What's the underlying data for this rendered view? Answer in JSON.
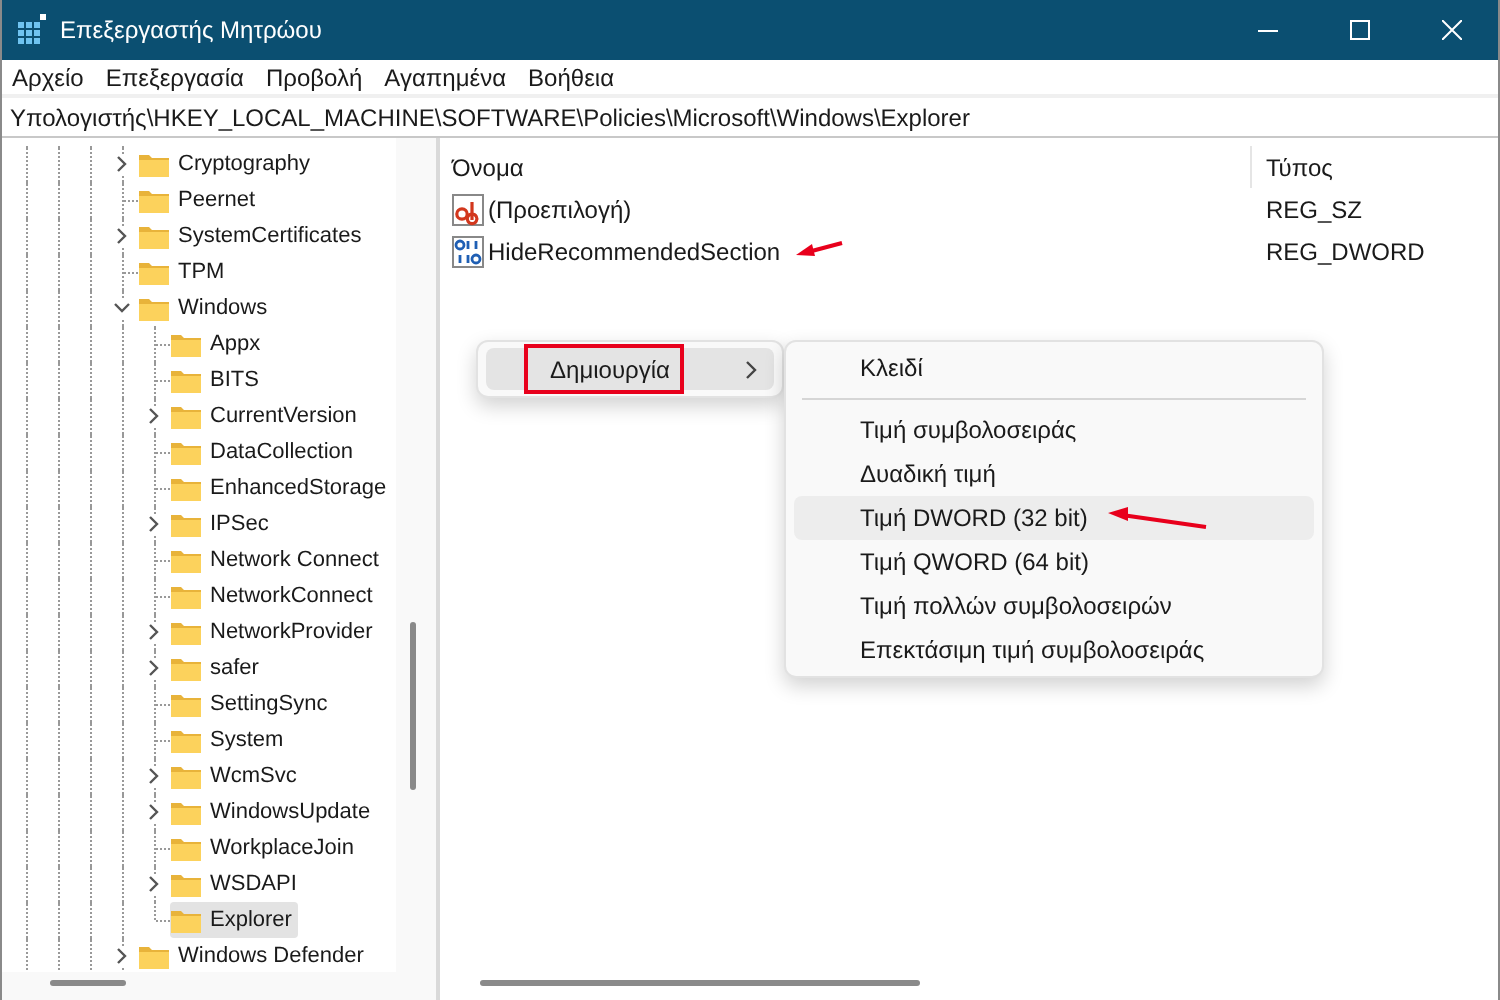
{
  "window": {
    "title": "Επεξεργαστής Μητρώου"
  },
  "menu_bar": [
    "Αρχείο",
    "Επεξεργασία",
    "Προβολή",
    "Αγαπημένα",
    "Βοήθεια"
  ],
  "address_bar": {
    "value": "Υπολογιστής\\HKEY_LOCAL_MACHINE\\SOFTWARE\\Policies\\Microsoft\\Windows\\Explorer"
  },
  "tree": [
    {
      "label": "Cryptography",
      "kind": "branch",
      "expanded": false,
      "selected": false
    },
    {
      "label": "Peernet",
      "kind": "leaf",
      "selected": false
    },
    {
      "label": "SystemCertificates",
      "kind": "branch",
      "expanded": false,
      "selected": false
    },
    {
      "label": "TPM",
      "kind": "leaf",
      "selected": false
    },
    {
      "label": "Windows",
      "kind": "branch",
      "expanded": true,
      "selected": false,
      "children": [
        {
          "label": "Appx",
          "kind": "leaf",
          "selected": false
        },
        {
          "label": "BITS",
          "kind": "leaf",
          "selected": false
        },
        {
          "label": "CurrentVersion",
          "kind": "branch",
          "expanded": false,
          "selected": false
        },
        {
          "label": "DataCollection",
          "kind": "leaf",
          "selected": false
        },
        {
          "label": "EnhancedStorage",
          "kind": "leaf",
          "selected": false
        },
        {
          "label": "IPSec",
          "kind": "branch",
          "expanded": false,
          "selected": false
        },
        {
          "label": "Network Connect",
          "kind": "leaf",
          "selected": false
        },
        {
          "label": "NetworkConnect",
          "kind": "leaf",
          "selected": false
        },
        {
          "label": "NetworkProvider",
          "kind": "branch",
          "expanded": false,
          "selected": false
        },
        {
          "label": "safer",
          "kind": "branch",
          "expanded": false,
          "selected": false
        },
        {
          "label": "SettingSync",
          "kind": "leaf",
          "selected": false
        },
        {
          "label": "System",
          "kind": "leaf",
          "selected": false
        },
        {
          "label": "WcmSvc",
          "kind": "branch",
          "expanded": false,
          "selected": false
        },
        {
          "label": "WindowsUpdate",
          "kind": "branch",
          "expanded": false,
          "selected": false
        },
        {
          "label": "WorkplaceJoin",
          "kind": "leaf",
          "selected": false
        },
        {
          "label": "WSDAPI",
          "kind": "branch",
          "expanded": false,
          "selected": false
        },
        {
          "label": "Explorer",
          "kind": "leaf",
          "selected": true
        }
      ]
    },
    {
      "label": "Windows Defender",
      "kind": "branch",
      "expanded": false,
      "selected": false
    }
  ],
  "values_table": {
    "columns": [
      "Όνομα",
      "Τύπος"
    ],
    "rows": [
      {
        "kind": "string",
        "name": "(Προεπιλογή)",
        "type": "REG_SZ",
        "annotated": false
      },
      {
        "kind": "binary",
        "name": "HideRecommendedSection",
        "type": "REG_DWORD",
        "annotated": true
      }
    ]
  },
  "context_menu": {
    "items": [
      {
        "label": "Δημιουργία",
        "hovered": true,
        "highlighted": true
      }
    ],
    "submenu": [
      {
        "kind": "item",
        "label": "Κλειδί",
        "hovered": false,
        "annotated": false
      },
      {
        "kind": "separator"
      },
      {
        "kind": "item",
        "label": "Τιμή συμβολοσειράς",
        "hovered": false,
        "annotated": false
      },
      {
        "kind": "item",
        "label": "Δυαδική τιμή",
        "hovered": false,
        "annotated": false
      },
      {
        "kind": "item",
        "label": "Τιμή DWORD (32 bit)",
        "hovered": true,
        "annotated": true
      },
      {
        "kind": "item",
        "label": "Τιμή QWORD (64 bit)",
        "hovered": false,
        "annotated": false
      },
      {
        "kind": "item",
        "label": "Τιμή πολλών συμβολοσειρών",
        "hovered": false,
        "annotated": false
      },
      {
        "kind": "item",
        "label": "Επεκτάσιμη τιμή συμβολοσειράς",
        "hovered": false,
        "annotated": false
      }
    ]
  }
}
